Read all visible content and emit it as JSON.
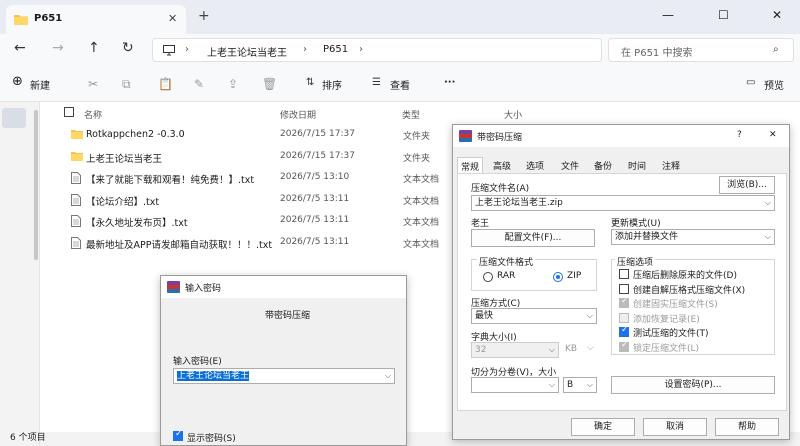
{
  "window": {
    "tab_title": "P651",
    "new_tab": "+",
    "minimize": "—",
    "maximize": "☐",
    "close": "✕"
  },
  "address": {
    "crumbs": [
      "上老王论坛当老王",
      "P651"
    ],
    "search_placeholder": "在 P651 中搜索"
  },
  "toolbar": {
    "new_label": "新建",
    "sort_label": "排序",
    "view_label": "查看",
    "more": "···",
    "preview_label": "预览"
  },
  "columns": {
    "name": "名称",
    "modified": "修改日期",
    "type": "类型",
    "size": "大小"
  },
  "files": [
    {
      "name": "Rotkappchen2 -0.3.0",
      "date": "2026/7/15 17:37",
      "type": "文件夹",
      "kind": "folder"
    },
    {
      "name": "上老王论坛当老王",
      "date": "2026/7/15 17:37",
      "type": "文件夹",
      "kind": "folder"
    },
    {
      "name": "【来了就能下载和观看！纯免费！】.txt",
      "date": "2026/7/5 13:10",
      "type": "文本文档",
      "kind": "txt"
    },
    {
      "name": "【论坛介绍】.txt",
      "date": "2026/7/5 13:11",
      "type": "文本文档",
      "kind": "txt"
    },
    {
      "name": "【永久地址发布页】.txt",
      "date": "2026/7/5 13:11",
      "type": "文本文档",
      "kind": "txt"
    },
    {
      "name": "最新地址及APP请发邮箱自动获取！！！.txt",
      "date": "2026/7/5 13:11",
      "type": "文本文档",
      "kind": "txt"
    }
  ],
  "status": {
    "count": "6 个项目"
  },
  "password_dialog": {
    "title": "输入密码",
    "subtitle": "带密码压缩",
    "prompt": "输入密码(E)",
    "value": "上老王论坛当老王",
    "show_password": "显示密码(S)"
  },
  "archive_dialog": {
    "title": "带密码压缩",
    "help": "?",
    "close": "✕",
    "tabs": [
      "常规",
      "高级",
      "选项",
      "文件",
      "备份",
      "时间",
      "注释"
    ],
    "archive_name_label": "压缩文件名(A)",
    "browse": "浏览(B)...",
    "archive_name": "上老王论坛当老王.zip",
    "profile_label": "老王",
    "profile_button": "配置文件(F)...",
    "update_mode_label": "更新模式(U)",
    "update_mode": "添加并替换文件",
    "format_label": "压缩文件格式",
    "format_rar": "RAR",
    "format_zip": "ZIP",
    "method_label": "压缩方式(C)",
    "method": "最快",
    "dict_label": "字典大小(I)",
    "dict_value": "32",
    "dict_unit": "KB",
    "split_label": "切分为分卷(V)，大小",
    "split_unit": "B",
    "options_label": "压缩选项",
    "options": [
      {
        "label": "压缩后删除原来的文件(D)",
        "checked": false,
        "disabled": false
      },
      {
        "label": "创建自解压格式压缩文件(X)",
        "checked": false,
        "disabled": false
      },
      {
        "label": "创建固实压缩文件(S)",
        "checked": true,
        "disabled": true
      },
      {
        "label": "添加恢复记录(E)",
        "checked": false,
        "disabled": true
      },
      {
        "label": "测试压缩的文件(T)",
        "checked": true,
        "disabled": false
      },
      {
        "label": "锁定压缩文件(L)",
        "checked": true,
        "disabled": true
      }
    ],
    "set_password": "设置密码(P)...",
    "ok": "确定",
    "cancel": "取消",
    "help_button": "帮助"
  }
}
